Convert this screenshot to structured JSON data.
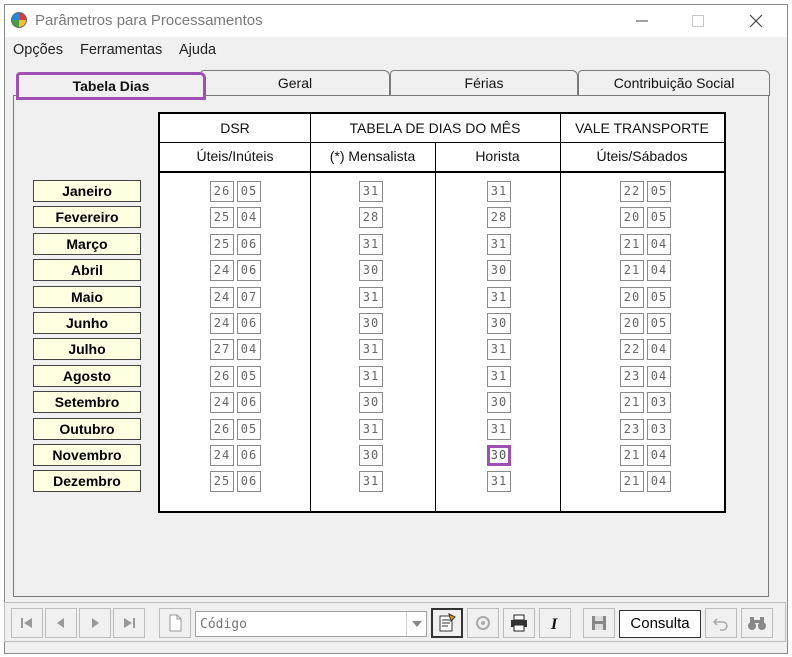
{
  "window": {
    "title": "Parâmetros para Processamentos"
  },
  "menu": [
    "Opções",
    "Ferramentas",
    "Ajuda"
  ],
  "tabs": [
    {
      "label": "Tabela Dias",
      "active": true
    },
    {
      "label": "Geral",
      "active": false
    },
    {
      "label": "Férias",
      "active": false
    },
    {
      "label": "Contribuição Social",
      "active": false
    }
  ],
  "headers": {
    "dsr": "DSR",
    "tabela": "TABELA DE DIAS DO MÊS",
    "vale": "VALE TRANSPORTE",
    "dsr_sub": "Úteis/Inúteis",
    "mensalista": "(*) Mensalista",
    "horista": "Horista",
    "vale_sub": "Úteis/Sábados"
  },
  "months": [
    {
      "name": "Janeiro",
      "dsr": [
        "26",
        "05"
      ],
      "mensalista": "31",
      "horista": "31",
      "vt": [
        "22",
        "05"
      ]
    },
    {
      "name": "Fevereiro",
      "dsr": [
        "25",
        "04"
      ],
      "mensalista": "28",
      "horista": "28",
      "vt": [
        "20",
        "05"
      ]
    },
    {
      "name": "Março",
      "dsr": [
        "25",
        "06"
      ],
      "mensalista": "31",
      "horista": "31",
      "vt": [
        "21",
        "04"
      ]
    },
    {
      "name": "Abril",
      "dsr": [
        "24",
        "06"
      ],
      "mensalista": "30",
      "horista": "30",
      "vt": [
        "21",
        "04"
      ]
    },
    {
      "name": "Maio",
      "dsr": [
        "24",
        "07"
      ],
      "mensalista": "31",
      "horista": "31",
      "vt": [
        "20",
        "05"
      ]
    },
    {
      "name": "Junho",
      "dsr": [
        "24",
        "06"
      ],
      "mensalista": "30",
      "horista": "30",
      "vt": [
        "20",
        "05"
      ]
    },
    {
      "name": "Julho",
      "dsr": [
        "27",
        "04"
      ],
      "mensalista": "31",
      "horista": "31",
      "vt": [
        "22",
        "04"
      ]
    },
    {
      "name": "Agosto",
      "dsr": [
        "26",
        "05"
      ],
      "mensalista": "31",
      "horista": "31",
      "vt": [
        "23",
        "04"
      ]
    },
    {
      "name": "Setembro",
      "dsr": [
        "24",
        "06"
      ],
      "mensalista": "30",
      "horista": "30",
      "vt": [
        "21",
        "03"
      ]
    },
    {
      "name": "Outubro",
      "dsr": [
        "26",
        "05"
      ],
      "mensalista": "31",
      "horista": "31",
      "vt": [
        "23",
        "03"
      ]
    },
    {
      "name": "Novembro",
      "dsr": [
        "24",
        "06"
      ],
      "mensalista": "30",
      "horista": "30",
      "vt": [
        "21",
        "04"
      ]
    },
    {
      "name": "Dezembro",
      "dsr": [
        "25",
        "06"
      ],
      "mensalista": "31",
      "horista": "31",
      "vt": [
        "21",
        "04"
      ]
    }
  ],
  "focused_month": "Novembro",
  "toolbar": {
    "code_placeholder": "Código",
    "mode": "Consulta",
    "icons": [
      "first-record-icon",
      "prev-record-icon",
      "next-record-icon",
      "last-record-icon",
      "new-document-icon",
      "code-dropdown-icon",
      "report-icon",
      "settings-icon",
      "print-icon",
      "italic-icon",
      "save-icon",
      "undo-icon",
      "binoculars-icon"
    ]
  },
  "colors": {
    "focus": "#a050b4",
    "month_bg": "#ffffe1"
  }
}
